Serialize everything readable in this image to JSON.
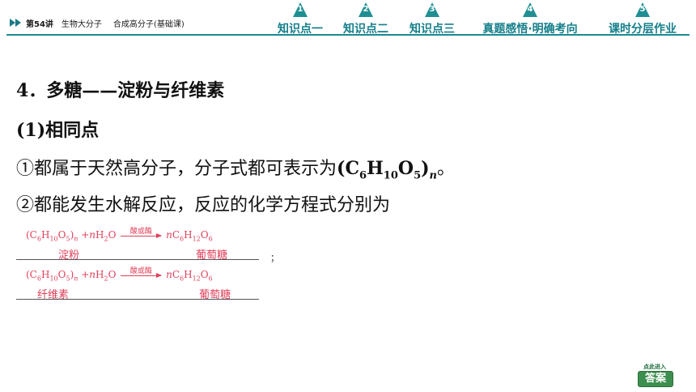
{
  "header": {
    "lecture_number": "第54讲",
    "lecture_title": "生物大分子",
    "lecture_subtitle": "合成高分子(基础课)",
    "nav": [
      {
        "number": "1",
        "label": "知识点一"
      },
      {
        "number": "2",
        "label": "知识点二"
      },
      {
        "number": "3",
        "label": "知识点三"
      },
      {
        "number": "4",
        "label": "真题感悟·明确考向"
      },
      {
        "number": "5",
        "label": "课时分层作业"
      }
    ]
  },
  "content": {
    "section_heading": "4．多糖——淀粉与纤维素",
    "subsection": "(1)相同点",
    "point1_text": "①都属于天然高分子，分子式都可表示为",
    "point1_formula": {
      "c": "C",
      "c_sub": "6",
      "h": "H",
      "h_sub": "10",
      "o": "O",
      "o_sub": "5",
      "n": "n"
    },
    "point1_end": "。",
    "point2_text": "②都能发生水解反应，反应的化学方程式分别为",
    "reactions": [
      {
        "left": "(C",
        "subs": [
          "6",
          "10",
          "5"
        ],
        "plus": "+",
        "water_coef": "n",
        "condition": "酸或酶",
        "product_coef": "n",
        "reactant_name": "淀粉",
        "product_name": "葡萄糖",
        "end": "；"
      },
      {
        "left": "(C",
        "subs": [
          "6",
          "10",
          "5"
        ],
        "plus": "+",
        "water_coef": "n",
        "condition": "酸或酶",
        "product_coef": "n",
        "reactant_name": "纤维素",
        "product_name": "葡萄糖",
        "end": ""
      }
    ]
  },
  "answer_button": {
    "top_text": "点此进入",
    "label": "答案"
  },
  "colors": {
    "teal": "#157f8a",
    "reaction_red": "#e0405a",
    "answer_green": "#3d8f4f"
  }
}
